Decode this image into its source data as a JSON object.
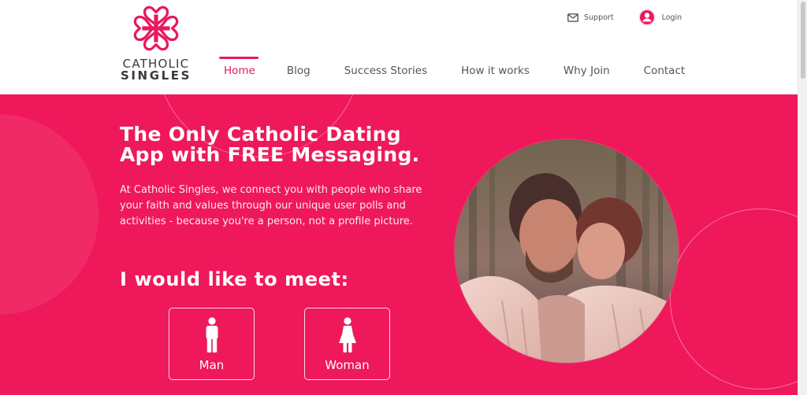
{
  "brand": {
    "line1": "CATHOLIC",
    "line2": "SINGLES",
    "logo_icon": "heart-cross-logo-icon",
    "accent_color": "#e8195c"
  },
  "top_links": {
    "support": "Support",
    "login": "Login"
  },
  "nav": {
    "items": [
      {
        "label": "Home",
        "active": true
      },
      {
        "label": "Blog"
      },
      {
        "label": "Success Stories"
      },
      {
        "label": "How it works"
      },
      {
        "label": "Why Join"
      },
      {
        "label": "Contact"
      }
    ]
  },
  "hero": {
    "background_color": "#ef185b",
    "headline": "The Only Catholic Dating App with FREE Messaging.",
    "blurb": "At Catholic Singles, we connect you with people who share your faith and values through our unique user polls and activities - because you're a person, not a profile picture.",
    "meet_heading": "I would like to meet:",
    "options": [
      {
        "label": "Man",
        "icon": "man-icon"
      },
      {
        "label": "Woman",
        "icon": "woman-icon"
      }
    ]
  }
}
